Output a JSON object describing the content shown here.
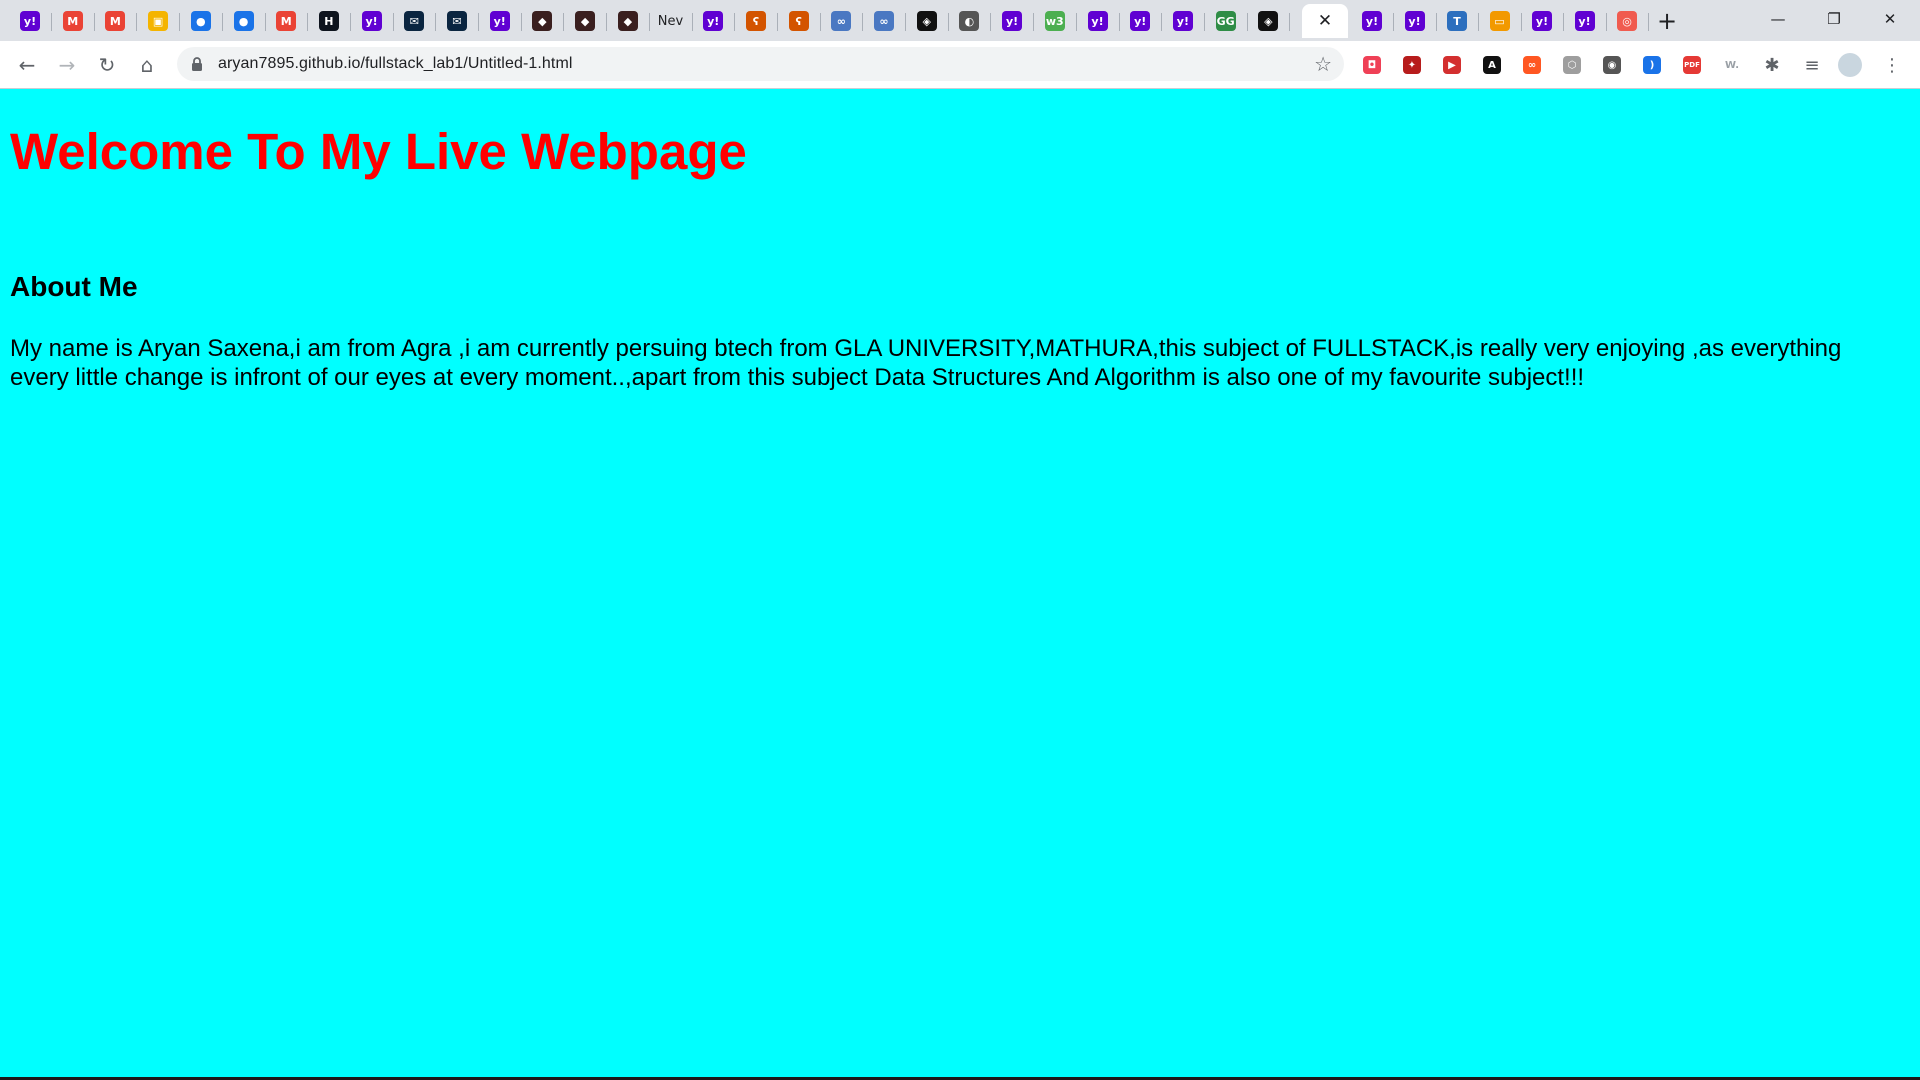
{
  "browser": {
    "tabs": [
      {
        "icon": "yahoo-icon",
        "glyph": "y!",
        "color": "#6001d2"
      },
      {
        "icon": "gmail-icon",
        "glyph": "M",
        "color": "#ea4335"
      },
      {
        "icon": "gmail-icon",
        "glyph": "M",
        "color": "#ea4335"
      },
      {
        "icon": "google-classroom-icon",
        "glyph": "▣",
        "color": "#f4b400"
      },
      {
        "icon": "contacts-icon",
        "glyph": "●",
        "color": "#1a73e8"
      },
      {
        "icon": "contacts-icon",
        "glyph": "●",
        "color": "#1a73e8"
      },
      {
        "icon": "gmail-icon",
        "glyph": "M",
        "color": "#ea4335"
      },
      {
        "icon": "hackerrank-icon",
        "glyph": "H",
        "color": "#0e141e"
      },
      {
        "icon": "yahoo-icon",
        "glyph": "y!",
        "color": "#6001d2"
      },
      {
        "icon": "mail-icon",
        "glyph": "✉",
        "color": "#0a2540"
      },
      {
        "icon": "mail-icon",
        "glyph": "✉",
        "color": "#0a2540"
      },
      {
        "icon": "yahoo-icon",
        "glyph": "y!",
        "color": "#6001d2"
      },
      {
        "icon": "app-icon",
        "glyph": "◆",
        "color": "#3a1f1f"
      },
      {
        "icon": "app-icon",
        "glyph": "◆",
        "color": "#3a1f1f"
      },
      {
        "icon": "app-icon",
        "glyph": "◆",
        "color": "#3a1f1f"
      },
      {
        "icon": "newtab-text-icon",
        "glyph": "Nev",
        "color": "#ffffff"
      },
      {
        "icon": "yahoo-icon",
        "glyph": "y!",
        "color": "#6001d2"
      },
      {
        "icon": "codechef-icon",
        "glyph": "ʕ",
        "color": "#d35400"
      },
      {
        "icon": "codechef-icon",
        "glyph": "ʕ",
        "color": "#d35400"
      },
      {
        "icon": "infinity-icon",
        "glyph": "∞",
        "color": "#4a78c2"
      },
      {
        "icon": "infinity-icon",
        "glyph": "∞",
        "color": "#4a78c2"
      },
      {
        "icon": "codepen-icon",
        "glyph": "◈",
        "color": "#111111"
      },
      {
        "icon": "globe-icon",
        "glyph": "◐",
        "color": "#555555"
      },
      {
        "icon": "yahoo-icon",
        "glyph": "y!",
        "color": "#6001d2"
      },
      {
        "icon": "w3schools-icon",
        "glyph": "w3",
        "color": "#4caf50"
      },
      {
        "icon": "yahoo-icon",
        "glyph": "y!",
        "color": "#6001d2"
      },
      {
        "icon": "yahoo-icon",
        "glyph": "y!",
        "color": "#6001d2"
      },
      {
        "icon": "yahoo-icon",
        "glyph": "y!",
        "color": "#6001d2"
      },
      {
        "icon": "geeksforgeeks-icon",
        "glyph": "GG",
        "color": "#2f8d46"
      },
      {
        "icon": "codepen-icon",
        "glyph": "◈",
        "color": "#111111"
      }
    ],
    "tabs_after_active": [
      {
        "icon": "yahoo-icon",
        "glyph": "y!",
        "color": "#6001d2"
      },
      {
        "icon": "yahoo-icon",
        "glyph": "y!",
        "color": "#6001d2"
      },
      {
        "icon": "tata-icon",
        "glyph": "T",
        "color": "#2c6fbe"
      },
      {
        "icon": "slides-icon",
        "glyph": "▭",
        "color": "#f29900"
      },
      {
        "icon": "yahoo-icon",
        "glyph": "y!",
        "color": "#6001d2"
      },
      {
        "icon": "yahoo-icon",
        "glyph": "y!",
        "color": "#6001d2"
      },
      {
        "icon": "target-icon",
        "glyph": "◎",
        "color": "#f05b4f"
      }
    ],
    "url": "aryan7895.github.io/fullstack_lab1/Untitled-1.html",
    "extensions": [
      {
        "icon": "pocket-icon",
        "glyph": "◘",
        "color": "#ef4056"
      },
      {
        "icon": "shield-icon",
        "glyph": "✦",
        "color": "#b71c1c"
      },
      {
        "icon": "video-icon",
        "glyph": "▶",
        "color": "#d32f2f"
      },
      {
        "icon": "a-icon",
        "glyph": "A",
        "color": "#111111"
      },
      {
        "icon": "loop-icon",
        "glyph": "∞",
        "color": "#ff5722"
      },
      {
        "icon": "hexagon-icon",
        "glyph": "⬡",
        "color": "#9e9e9e"
      },
      {
        "icon": "compass-icon",
        "glyph": "◉",
        "color": "#555555"
      },
      {
        "icon": "wave-icon",
        "glyph": ")",
        "color": "#1a73e8"
      },
      {
        "icon": "pdf-icon",
        "glyph": "PDF",
        "color": "#e53935"
      },
      {
        "icon": "w-icon",
        "glyph": "W.",
        "color": "#9aa0a6"
      }
    ]
  },
  "page": {
    "heading": "Welcome To My Live Webpage",
    "about_heading": "About Me",
    "bio": "My name is Aryan Saxena,i am from Agra ,i am currently persuing btech from GLA UNIVERSITY,MATHURA,this subject of FULLSTACK,is really very enjoying ,as everything every little change is infront of our eyes at every moment..,apart from this subject Data Structures And Algorithm is also one of my favourite subject!!!",
    "background_color": "#00ffff",
    "heading_color": "#ff0000"
  }
}
